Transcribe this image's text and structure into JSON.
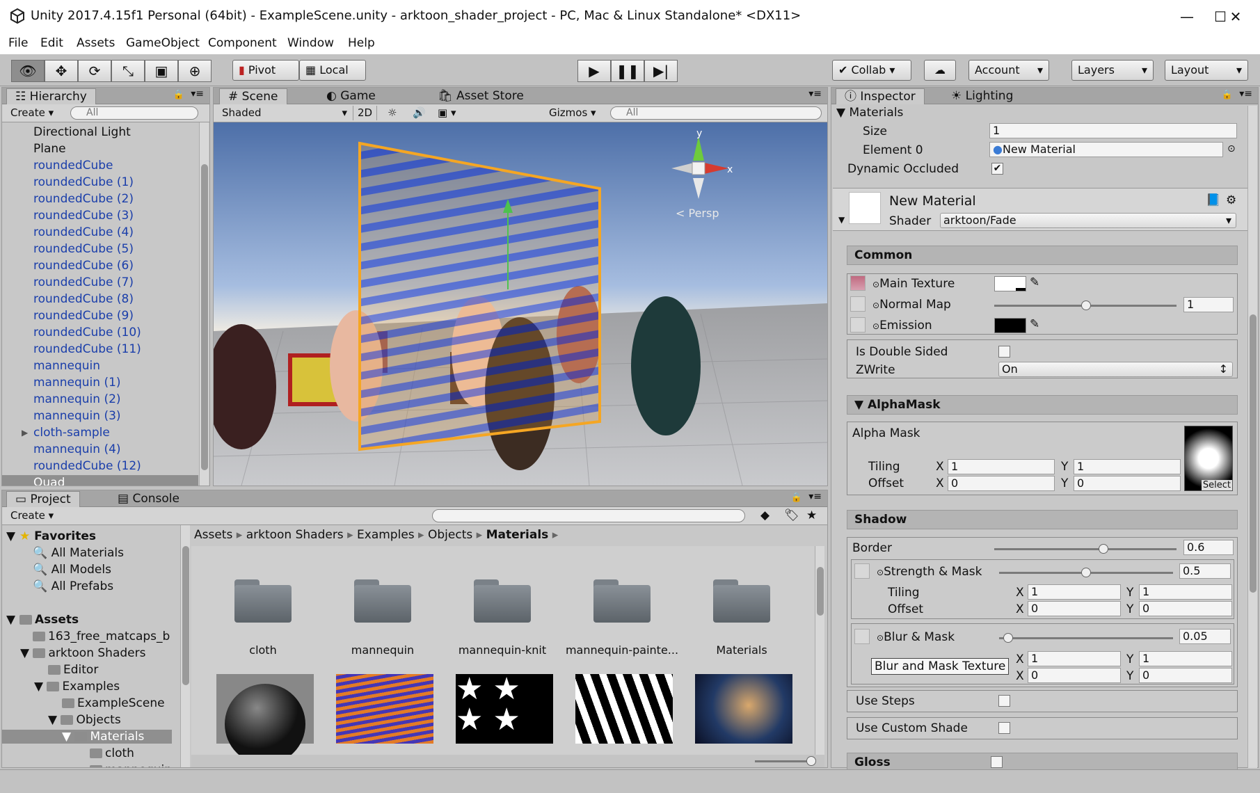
{
  "window": {
    "title": "Unity 2017.4.15f1 Personal (64bit) - ExampleScene.unity - arktoon_shader_project - PC, Mac & Linux Standalone* <DX11>",
    "minimize": "—",
    "maximize": "☐",
    "close": "✕"
  },
  "menu": [
    "File",
    "Edit",
    "Assets",
    "GameObject",
    "Component",
    "Window",
    "Help"
  ],
  "toolbar": {
    "pivot": "Pivot",
    "local": "Local",
    "collab": "Collab ▾",
    "account": "Account",
    "layers": "Layers",
    "layout": "Layout"
  },
  "hierarchy": {
    "tab": "Hierarchy",
    "create": "Create ▾",
    "search_placeholder": "All",
    "items": [
      {
        "label": "Directional Light",
        "prefab": false
      },
      {
        "label": "Plane",
        "prefab": false
      },
      {
        "label": "roundedCube",
        "prefab": true
      },
      {
        "label": "roundedCube (1)",
        "prefab": true
      },
      {
        "label": "roundedCube (2)",
        "prefab": true
      },
      {
        "label": "roundedCube (3)",
        "prefab": true
      },
      {
        "label": "roundedCube (4)",
        "prefab": true
      },
      {
        "label": "roundedCube (5)",
        "prefab": true
      },
      {
        "label": "roundedCube (6)",
        "prefab": true
      },
      {
        "label": "roundedCube (7)",
        "prefab": true
      },
      {
        "label": "roundedCube (8)",
        "prefab": true
      },
      {
        "label": "roundedCube (9)",
        "prefab": true
      },
      {
        "label": "roundedCube (10)",
        "prefab": true
      },
      {
        "label": "roundedCube (11)",
        "prefab": true
      },
      {
        "label": "mannequin",
        "prefab": true
      },
      {
        "label": "mannequin (1)",
        "prefab": true
      },
      {
        "label": "mannequin (2)",
        "prefab": true
      },
      {
        "label": "mannequin (3)",
        "prefab": true
      },
      {
        "label": "cloth-sample",
        "prefab": true
      },
      {
        "label": "mannequin (4)",
        "prefab": true
      },
      {
        "label": "roundedCube (12)",
        "prefab": true
      },
      {
        "label": "Quad",
        "prefab": false
      }
    ]
  },
  "scene": {
    "tabs": [
      "Scene",
      "Game",
      "Asset Store"
    ],
    "shading": "Shaded",
    "mode2d": "2D",
    "gizmos": "Gizmos ▾",
    "search_placeholder": "All",
    "persp": "< Persp",
    "axis_x": "x",
    "axis_y": "y"
  },
  "project": {
    "tabs": [
      "Project",
      "Console"
    ],
    "create": "Create ▾",
    "favorites_title": "Favorites",
    "favorites": [
      "All Materials",
      "All Models",
      "All Prefabs"
    ],
    "assets_title": "Assets",
    "tree": [
      "163_free_matcaps_b",
      "arktoon Shaders",
      "Editor",
      "Examples",
      "ExampleScene",
      "Objects",
      "Materials",
      "cloth",
      "mannequin"
    ],
    "breadcrumb": [
      "Assets",
      "arktoon Shaders",
      "Examples",
      "Objects",
      "Materials"
    ],
    "folders": [
      "cloth",
      "mannequin",
      "mannequin-knit",
      "mannequin-painte...",
      "Materials"
    ]
  },
  "inspector": {
    "tabs": [
      "Inspector",
      "Lighting"
    ],
    "materials_label": "Materials",
    "size_label": "Size",
    "size_value": "1",
    "element0_label": "Element 0",
    "element0_value": "New Material",
    "dynamic_occluded_label": "Dynamic Occluded",
    "material_name": "New Material",
    "shader_label": "Shader",
    "shader_value": "arktoon/Fade",
    "common": {
      "title": "Common",
      "main_texture": "Main Texture",
      "normal_map": "Normal Map",
      "normal_map_value": "1",
      "emission": "Emission",
      "is_double_sided": "Is Double Sided",
      "zwrite": "ZWrite",
      "zwrite_value": "On"
    },
    "alphamask": {
      "title": "AlphaMask",
      "label": "Alpha Mask",
      "tiling": "Tiling",
      "offset": "Offset",
      "tiling_x": "1",
      "tiling_y": "1",
      "offset_x": "0",
      "offset_y": "0",
      "select": "Select"
    },
    "shadow": {
      "title": "Shadow",
      "border": "Border",
      "border_value": "0.6",
      "border_fraction": 0.6,
      "strength_mask": "Strength & Mask",
      "strength_value": "0.5",
      "strength_fraction": 0.5,
      "tiling": "Tiling",
      "offset": "Offset",
      "tiling_x": "1",
      "tiling_y": "1",
      "offset_x": "0",
      "offset_y": "0",
      "blur_mask": "Blur & Mask",
      "blur_value": "0.05",
      "blur_fraction": 0.05,
      "tooltip": "Blur and Mask Texture",
      "blur_tiling_x": "1",
      "blur_tiling_y": "1",
      "blur_offset_x": "0",
      "blur_offset_y": "0",
      "use_steps": "Use Steps",
      "use_custom_shade": "Use Custom Shade"
    },
    "gloss": {
      "title": "Gloss"
    }
  },
  "axis_labels": {
    "x": "X",
    "y": "Y"
  }
}
